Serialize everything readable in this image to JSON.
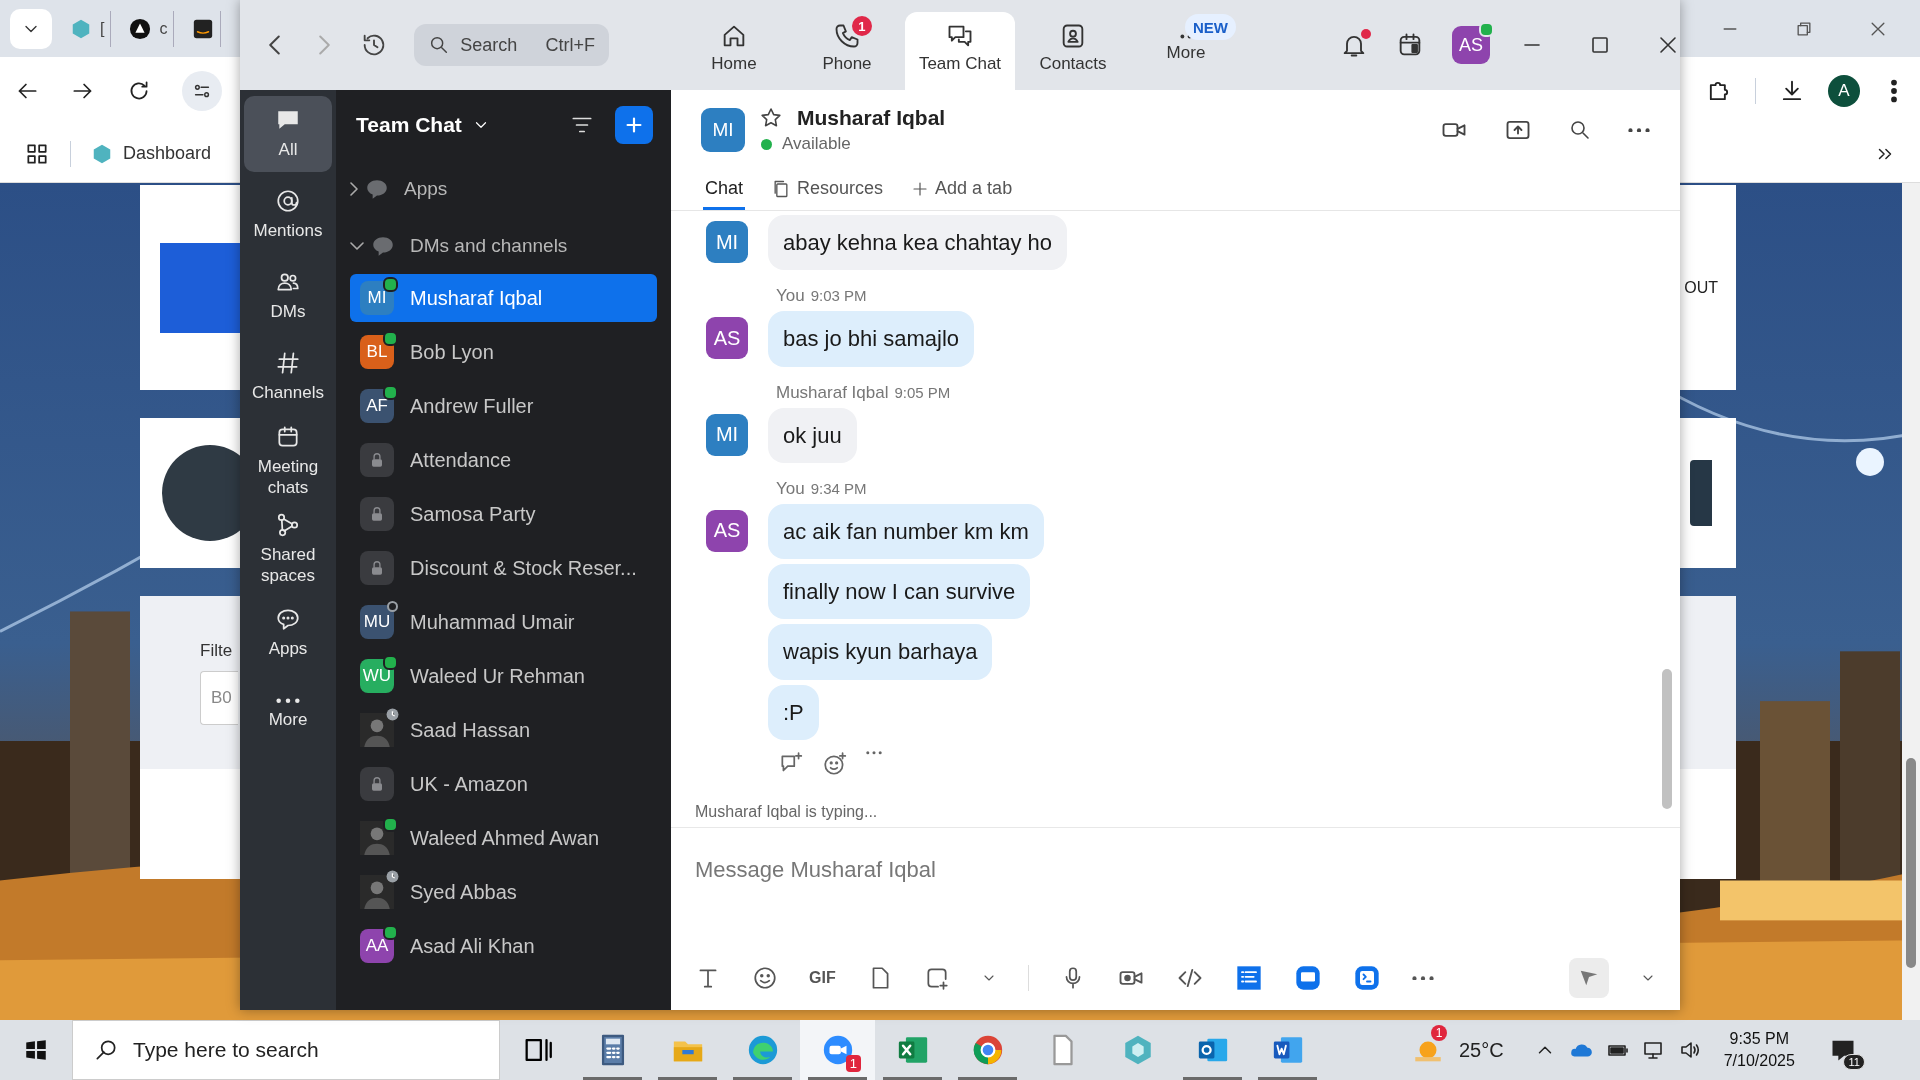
{
  "browser": {
    "tabs": [
      {
        "kind": "hex",
        "title": "[",
        "selected": false
      },
      {
        "kind": "triangle",
        "title": "c",
        "selected": false
      },
      {
        "kind": "square",
        "selected": false
      }
    ],
    "bookmarks": [
      {
        "label": "Dashboard"
      }
    ],
    "profile": "A",
    "page": {
      "logout_fragment": "OUT",
      "filter_label": "Filte",
      "filter_value": "B0"
    }
  },
  "zoom": {
    "search": {
      "placeholder": "Search",
      "shortcut": "Ctrl+F"
    },
    "nav": [
      {
        "kind": "home",
        "label": "Home",
        "selected": false
      },
      {
        "kind": "phone",
        "label": "Phone",
        "badge": "1",
        "selected": false
      },
      {
        "kind": "chat",
        "label": "Team Chat",
        "selected": true
      },
      {
        "kind": "contacts",
        "label": "Contacts",
        "selected": false
      },
      {
        "kind": "more",
        "label": "More",
        "badge": "NEW",
        "selected": false
      }
    ],
    "user": {
      "initials": "AS",
      "color": "#8e44ad",
      "online": true
    },
    "notifications_unread": true,
    "rail": [
      {
        "kind": "all",
        "label": "All",
        "selected": true
      },
      {
        "kind": "mentions",
        "label": "Mentions",
        "selected": false
      },
      {
        "kind": "dms",
        "label": "DMs",
        "selected": false
      },
      {
        "kind": "channels",
        "label": "Channels",
        "selected": false
      },
      {
        "kind": "meetings",
        "label": "Meeting chats",
        "selected": false
      },
      {
        "kind": "shared",
        "label": "Shared spaces",
        "selected": false
      },
      {
        "kind": "apps",
        "label": "Apps",
        "selected": false
      },
      {
        "kind": "more",
        "label": "More",
        "selected": false
      }
    ],
    "panel_title": "Team Chat",
    "sections": [
      {
        "label": "Apps",
        "expanded": false
      },
      {
        "label": "DMs and channels",
        "expanded": true,
        "children": [
          {
            "kind": "person",
            "initials": "MI",
            "name": "Musharaf Iqbal",
            "color": "#2d7fc1",
            "online": true,
            "selected": true
          },
          {
            "kind": "person",
            "initials": "BL",
            "name": "Bob Lyon",
            "color": "#d9601a",
            "online": true,
            "selected": false
          },
          {
            "kind": "person",
            "initials": "AF",
            "name": "Andrew Fuller",
            "color": "#3b5270",
            "online": true,
            "selected": false
          },
          {
            "kind": "channel",
            "name": "Attendance",
            "selected": false
          },
          {
            "kind": "channel",
            "name": "Samosa Party",
            "selected": false
          },
          {
            "kind": "channel",
            "name": "Discount & Stock Reser...",
            "selected": false
          },
          {
            "kind": "person",
            "initials": "MU",
            "name": "Muhammad Umair",
            "color": "#3b5270",
            "online": false,
            "selected": false
          },
          {
            "kind": "person",
            "initials": "WU",
            "name": "Waleed Ur Rehman",
            "color": "#27ae60",
            "online": true,
            "selected": false
          },
          {
            "name": "Saad Hassan",
            "away": true,
            "selected": false
          },
          {
            "kind": "channel",
            "name": "UK - Amazon",
            "selected": false
          },
          {
            "name": "Waleed Ahmed Awan",
            "online": true,
            "selected": false
          },
          {
            "name": "Syed Abbas",
            "away": true,
            "selected": false
          },
          {
            "kind": "person",
            "initials": "AA",
            "name": "Asad Ali Khan",
            "color": "#8e44ad",
            "online": true,
            "selected": false
          }
        ]
      }
    ],
    "chat": {
      "initials": "MI",
      "color": "#2d7fc1",
      "name": "Musharaf Iqbal",
      "starred": false,
      "presence": "Available",
      "online": true,
      "tabs": [
        {
          "kind": "text",
          "label": "Chat",
          "selected": true
        },
        {
          "kind": "resources",
          "label": "Resources",
          "selected": false
        },
        {
          "kind": "add",
          "label": "Add a tab",
          "selected": false
        }
      ],
      "messages": [
        {
          "mine": false,
          "initials": "MI",
          "color": "#2d7fc1",
          "bubbles": [
            "abay kehna kea chahtay ho"
          ]
        },
        {
          "mine": true,
          "sender": "You",
          "time": "9:03 PM",
          "initials": "AS",
          "color": "#8e44ad",
          "bubbles": [
            "bas jo bhi samajlo"
          ]
        },
        {
          "mine": false,
          "sender": "Musharaf Iqbal",
          "time": "9:05 PM",
          "initials": "MI",
          "color": "#2d7fc1",
          "bubbles": [
            "ok juu"
          ]
        },
        {
          "mine": true,
          "sender": "You",
          "time": "9:34 PM",
          "initials": "AS",
          "color": "#8e44ad",
          "bubbles": [
            "ac aik fan number km km",
            "finally now I can survive",
            "wapis kyun barhaya",
            ":P"
          ]
        }
      ],
      "typing": "Musharaf Iqbal  is typing...",
      "composer": {
        "placeholder": "Message Musharaf Iqbal",
        "gif": "GIF"
      }
    }
  },
  "taskbar": {
    "search_placeholder": "Type here to search",
    "apps": [
      {
        "kind": "taskview",
        "running": false,
        "selected": false
      },
      {
        "kind": "calculator",
        "running": true,
        "selected": false
      },
      {
        "kind": "explorer",
        "running": true,
        "selected": false
      },
      {
        "kind": "edge",
        "running": true,
        "selected": false
      },
      {
        "kind": "zoom",
        "running": true,
        "selected": true,
        "badge": "1"
      },
      {
        "kind": "excel",
        "running": true,
        "selected": false
      },
      {
        "kind": "chrome",
        "running": true,
        "selected": false
      },
      {
        "kind": "file",
        "running": false,
        "selected": false
      },
      {
        "kind": "hex",
        "running": false,
        "selected": false
      },
      {
        "kind": "outlook",
        "running": true,
        "selected": false
      },
      {
        "kind": "word",
        "running": true,
        "selected": false
      }
    ],
    "weather": {
      "temp": "25°C",
      "badge": "1"
    },
    "time": "9:35 PM",
    "date": "7/10/2025",
    "notifications": "11"
  }
}
